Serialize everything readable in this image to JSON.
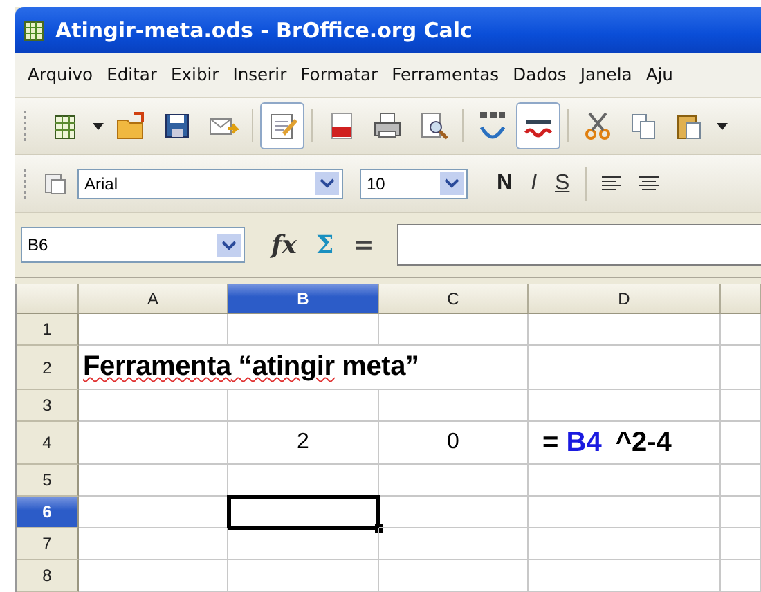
{
  "window": {
    "title": "Atingir-meta.ods - BrOffice.org Calc"
  },
  "menu": [
    "Arquivo",
    "Editar",
    "Exibir",
    "Inserir",
    "Formatar",
    "Ferramentas",
    "Dados",
    "Janela",
    "Aju"
  ],
  "toolbar": [
    {
      "kind": "new"
    },
    {
      "kind": "caret"
    },
    {
      "kind": "open"
    },
    {
      "kind": "save"
    },
    {
      "kind": "mail"
    },
    {
      "kind": "sep"
    },
    {
      "kind": "edit",
      "pressed": true
    },
    {
      "kind": "sep"
    },
    {
      "kind": "pdf"
    },
    {
      "kind": "print"
    },
    {
      "kind": "preview"
    },
    {
      "kind": "sep"
    },
    {
      "kind": "spell"
    },
    {
      "kind": "autospell",
      "pressed": true
    },
    {
      "kind": "sep"
    },
    {
      "kind": "cut"
    },
    {
      "kind": "copy"
    },
    {
      "kind": "paste"
    },
    {
      "kind": "caret"
    }
  ],
  "format_bar": {
    "font": "Arial",
    "size": "10",
    "styles": [
      "N",
      "I",
      "S"
    ]
  },
  "formula_bar": {
    "cell_ref": "B6",
    "buttons": [
      "fx",
      "Σ",
      "="
    ]
  },
  "sheet": {
    "columns": [
      {
        "label": "A",
        "selected": false
      },
      {
        "label": "B",
        "selected": true
      },
      {
        "label": "C",
        "selected": false
      },
      {
        "label": "D",
        "selected": false
      }
    ],
    "rows": [
      {
        "label": "1",
        "selected": false,
        "cells": [
          "",
          "",
          "",
          ""
        ]
      },
      {
        "label": "2",
        "selected": false,
        "cells": [
          {
            "kind": "title",
            "segments": [
              {
                "text": "Ferramenta",
                "misspelled": true
              },
              {
                "text": " “atingir",
                "misspelled": true
              },
              {
                "text": " meta”",
                "misspelled": false
              }
            ]
          },
          ""
        ]
      },
      {
        "label": "3",
        "selected": false,
        "cells": [
          "",
          "",
          "",
          ""
        ]
      },
      {
        "label": "4",
        "selected": false,
        "cells": [
          "",
          "2",
          "0",
          {
            "kind": "formula",
            "segments": [
              {
                "text": "= "
              },
              {
                "text": "B4",
                "kind": "reference"
              },
              {
                "text": "^2-4"
              }
            ]
          }
        ]
      },
      {
        "label": "5",
        "selected": false,
        "cells": [
          "",
          "",
          "",
          ""
        ]
      },
      {
        "label": "6",
        "selected": true,
        "cells": [
          "",
          "",
          "",
          ""
        ]
      },
      {
        "label": "7",
        "selected": false,
        "cells": [
          "",
          "",
          "",
          ""
        ]
      },
      {
        "label": "8",
        "selected": false,
        "cells": [
          "",
          "",
          "",
          ""
        ]
      }
    ]
  }
}
